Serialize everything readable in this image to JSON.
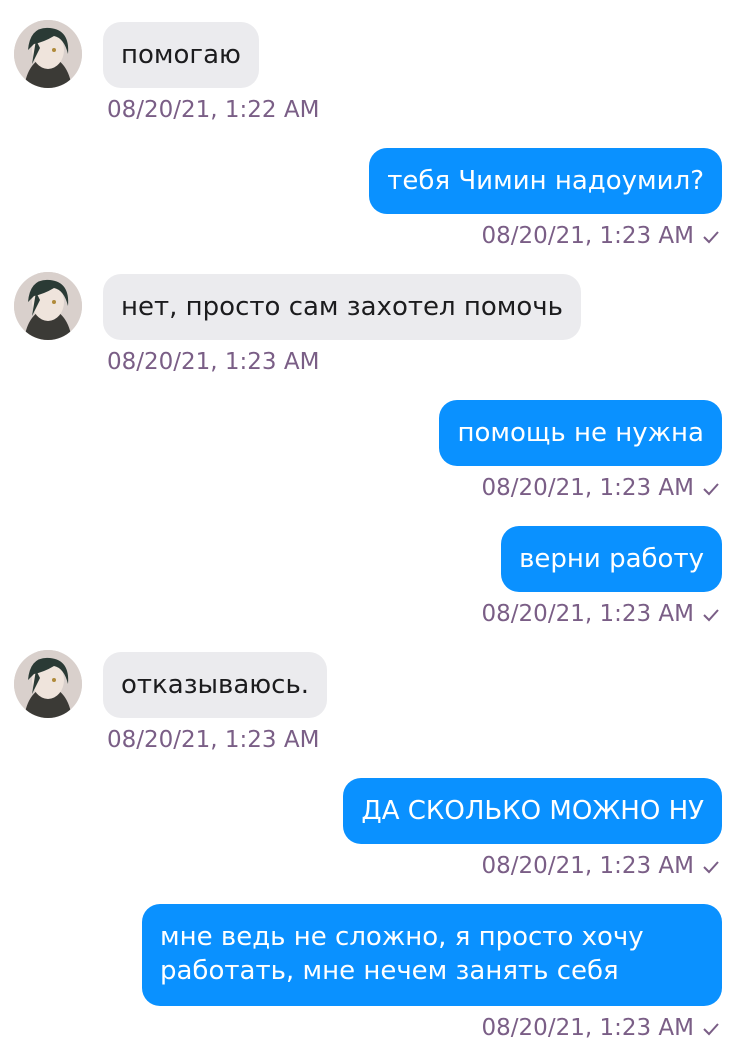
{
  "chat": {
    "messages": [
      {
        "side": "in",
        "text": "помогаю",
        "time": "08/20/21, 1:22 AM"
      },
      {
        "side": "out",
        "text": "тебя Чимин надоумил?",
        "time": "08/20/21, 1:23 AM",
        "status_icon": "check-icon"
      },
      {
        "side": "in",
        "text": "нет, просто сам захотел помочь",
        "time": "08/20/21, 1:23 AM"
      },
      {
        "side": "out",
        "text": "помощь не нужна",
        "time": "08/20/21, 1:23 AM",
        "status_icon": "check-icon"
      },
      {
        "side": "out",
        "text": "верни работу",
        "time": "08/20/21, 1:23 AM",
        "status_icon": "check-icon"
      },
      {
        "side": "in",
        "text": "отказываюсь.",
        "time": "08/20/21, 1:23 AM"
      },
      {
        "side": "out",
        "text": "ДА СКОЛЬКО МОЖНО НУ",
        "time": "08/20/21, 1:23 AM",
        "status_icon": "check-icon"
      },
      {
        "side": "out",
        "text": "мне ведь не сложно, я просто хочу работать, мне нечем занять себя",
        "time": "08/20/21, 1:23 AM",
        "status_icon": "check-icon"
      }
    ]
  },
  "colors": {
    "incoming_bubble": "#ebebee",
    "outgoing_bubble": "#0a91ff",
    "timestamp": "#7a5e86"
  }
}
